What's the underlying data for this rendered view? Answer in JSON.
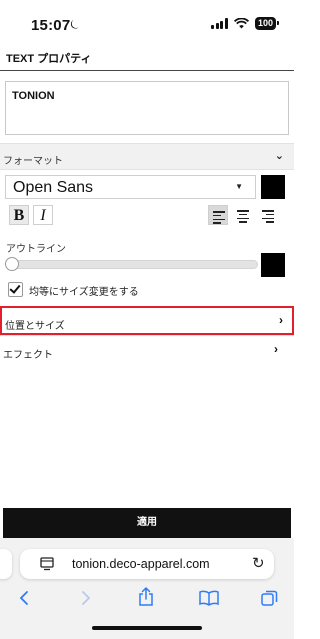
{
  "status": {
    "time": "15:07",
    "battery": "100"
  },
  "panel": {
    "title": "TEXT プロパティ"
  },
  "text_input": {
    "value": "TONION"
  },
  "format": {
    "label": "フォーマット",
    "chevron": "⌄"
  },
  "font": {
    "value": "Open Sans",
    "caret": "▼",
    "color": "#000000"
  },
  "style_buttons": {
    "bold": "B",
    "italic": "I"
  },
  "outline": {
    "label": "アウトライン",
    "level": 0,
    "color": "#000000"
  },
  "proportional_resize": {
    "label": "均等にサイズ変更をする",
    "checked": true
  },
  "position_size": {
    "label": "位置とサイズ",
    "chevron": "›"
  },
  "effect": {
    "label": "エフェクト",
    "chevron": "›"
  },
  "apply": {
    "label": "適用"
  },
  "browser": {
    "url": "tonion.deco-apparel.com",
    "icons": [
      "back-icon",
      "forward-icon",
      "share-icon",
      "bookmarks-icon",
      "tabs-icon"
    ]
  },
  "colors": {
    "highlight_border": "#e0202a",
    "safari_blue": "#2f7cf6"
  }
}
